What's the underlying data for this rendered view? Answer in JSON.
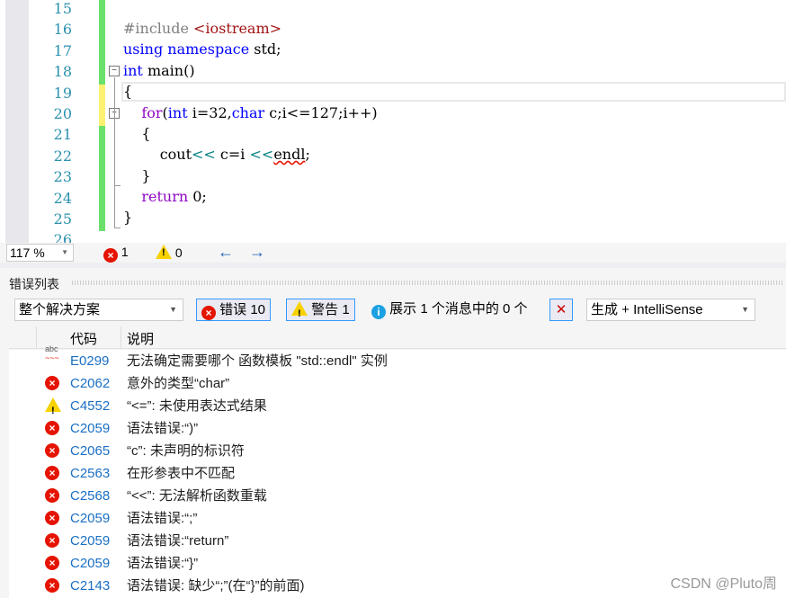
{
  "editor": {
    "line_numbers": [
      "15",
      "16",
      "17",
      "18",
      "19",
      "20",
      "21",
      "22",
      "23",
      "24",
      "25",
      "26"
    ],
    "zoom": "117 %",
    "error_count": "1",
    "warning_count": "0"
  },
  "error_list": {
    "title": "错误列表",
    "scope": "整个解决方案",
    "errors_btn": "错误 10",
    "warnings_btn": "警告 1",
    "messages_btn": "展示 1 个消息中的 0 个",
    "source": "生成 + IntelliSense",
    "col_code": "代码",
    "col_desc": "说明",
    "rows": [
      {
        "icon": "intellisense-squiggle-icon",
        "code": "E0299",
        "desc": "无法确定需要哪个 函数模板 \"std::endl\" 实例"
      },
      {
        "icon": "error-icon",
        "code": "C2062",
        "desc": "意外的类型“char”"
      },
      {
        "icon": "warning-icon",
        "code": "C4552",
        "desc": "“<=”: 未使用表达式结果"
      },
      {
        "icon": "error-icon",
        "code": "C2059",
        "desc": "语法错误:“)”"
      },
      {
        "icon": "error-icon",
        "code": "C2065",
        "desc": "“c”: 未声明的标识符"
      },
      {
        "icon": "error-icon",
        "code": "C2563",
        "desc": "在形参表中不匹配"
      },
      {
        "icon": "error-icon",
        "code": "C2568",
        "desc": "“<<”: 无法解析函数重载"
      },
      {
        "icon": "error-icon",
        "code": "C2059",
        "desc": "语法错误:“;”"
      },
      {
        "icon": "error-icon",
        "code": "C2059",
        "desc": "语法错误:“return”"
      },
      {
        "icon": "error-icon",
        "code": "C2059",
        "desc": "语法错误:“}”"
      },
      {
        "icon": "error-icon",
        "code": "C2143",
        "desc": "语法错误: 缺少“;”(在“}”的前面)"
      }
    ]
  },
  "watermark": "CSDN @Pluto周",
  "code_lines": {
    "l16a": "#include ",
    "l16b": "<iostream>",
    "l17a": "using namespace ",
    "l17b": "std;",
    "l18a": "int ",
    "l18b": "main()",
    "l19": "{",
    "l20a": "    for",
    "l20b": "(",
    "l20c": "int ",
    "l20d": "i=32,",
    "l20e": "char ",
    "l20f": "c;i<=127;i++)",
    "l21": "    {",
    "l22a": "        cout",
    "l22b": "<< ",
    "l22c": "c=i ",
    "l22d": "<<",
    "l22e": "endl",
    ";": ";",
    "l23": "    }",
    "l24a": "    return ",
    "l24b": "0;",
    "l25": "}"
  }
}
